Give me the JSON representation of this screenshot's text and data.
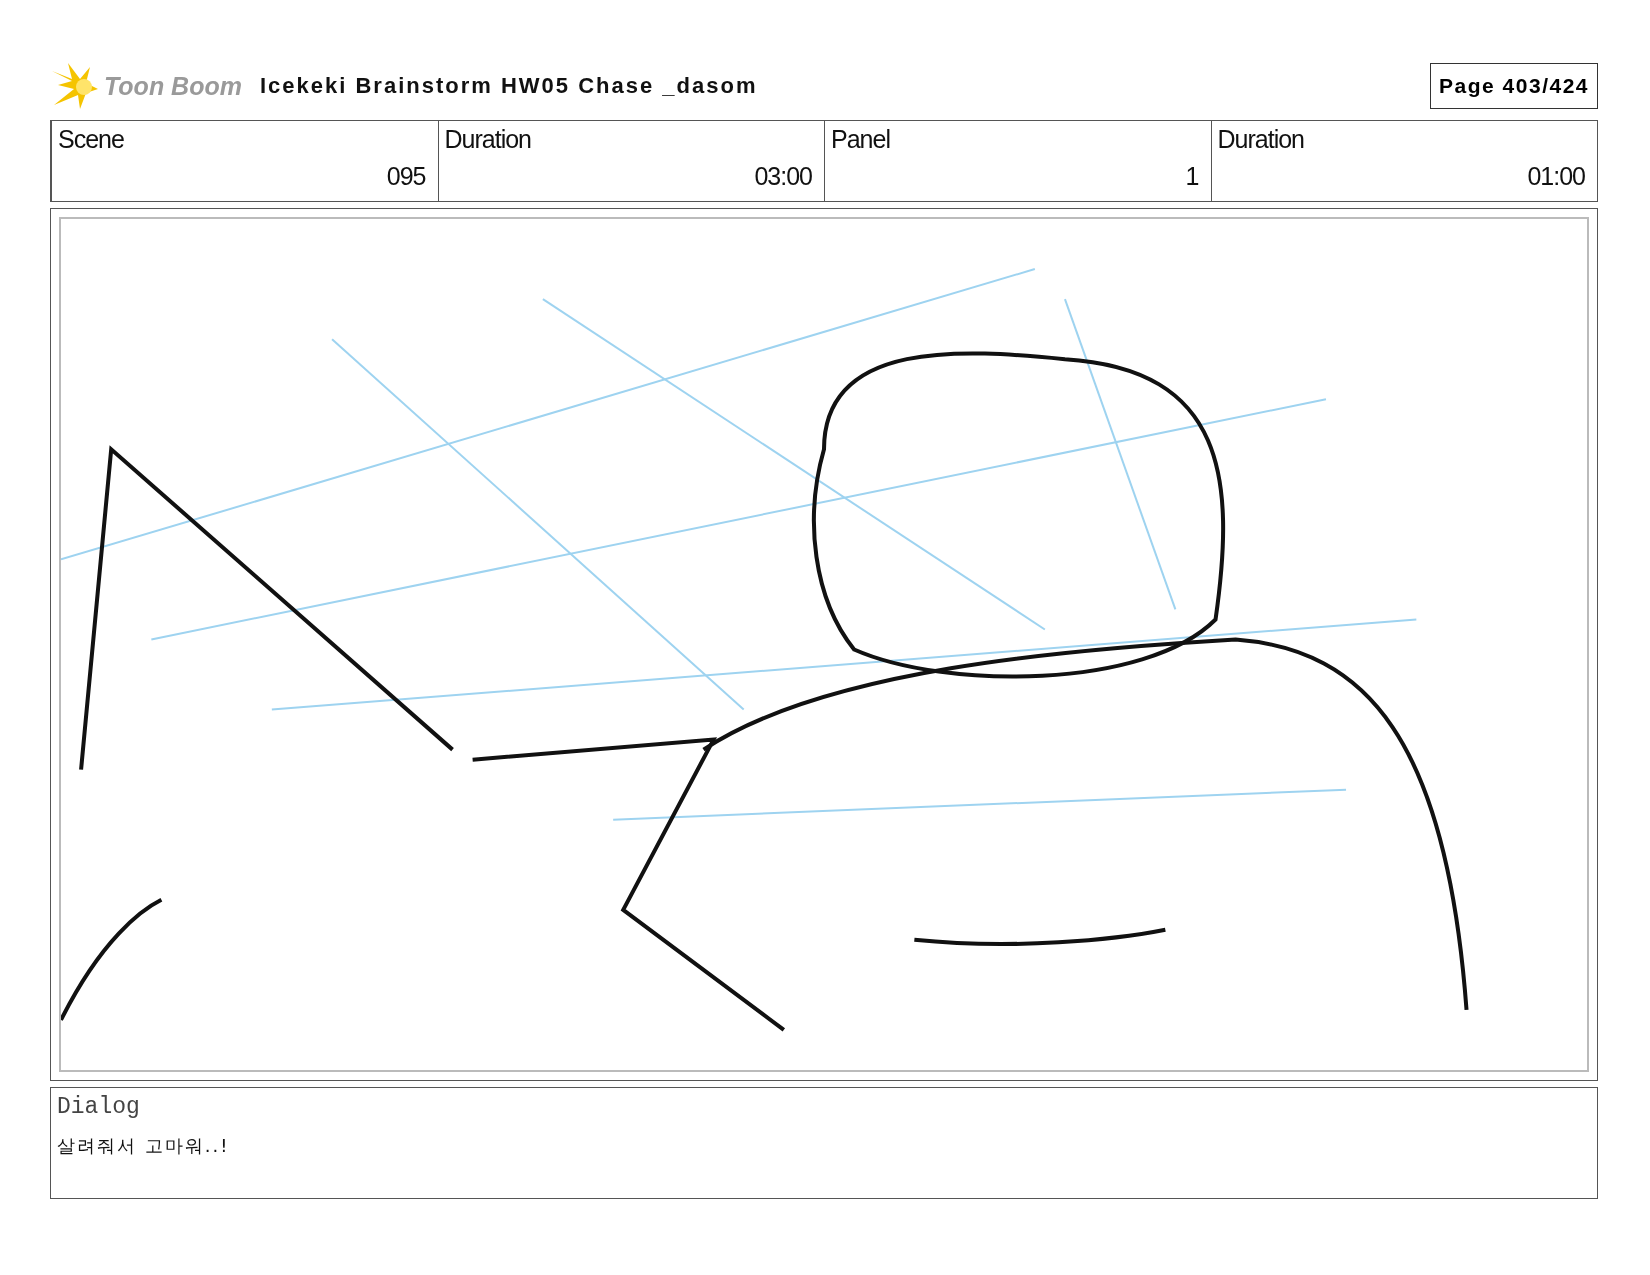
{
  "header": {
    "logo_text": "Toon Boom",
    "project_title": "Icekeki Brainstorm HW05 Chase _dasom",
    "page": "Page 403/424"
  },
  "info": {
    "labels": [
      "Scene",
      "Duration",
      "Panel",
      "Duration"
    ],
    "values": [
      "095",
      "03:00",
      "1",
      "01:00"
    ]
  },
  "dialog": {
    "label": "Dialog",
    "text": "살려줘서 고마워..!"
  }
}
